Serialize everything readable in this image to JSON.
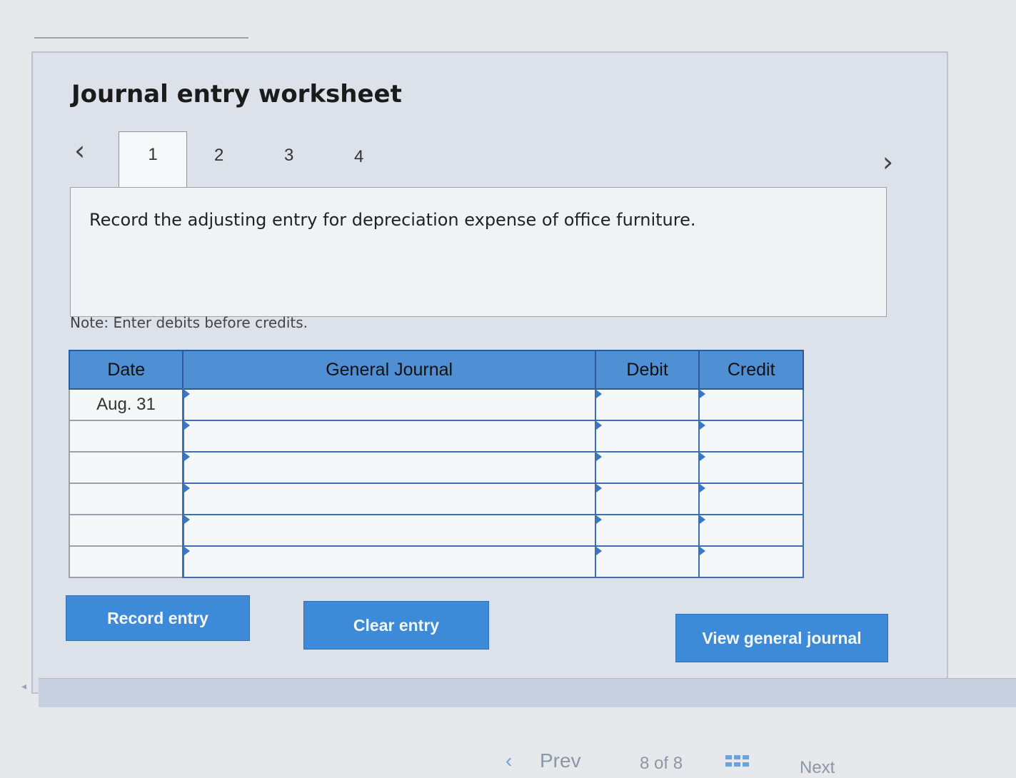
{
  "worksheet": {
    "title": "Journal entry worksheet",
    "tabs": [
      "1",
      "2",
      "3",
      "4"
    ],
    "active_tab": "1",
    "prompt": "Record the adjusting entry for depreciation expense of office furniture.",
    "note": "Note: Enter debits before credits."
  },
  "table": {
    "headers": {
      "date": "Date",
      "journal": "General Journal",
      "debit": "Debit",
      "credit": "Credit"
    },
    "rows": [
      {
        "date": "Aug. 31",
        "account": "",
        "debit": "",
        "credit": ""
      },
      {
        "date": "",
        "account": "",
        "debit": "",
        "credit": ""
      },
      {
        "date": "",
        "account": "",
        "debit": "",
        "credit": ""
      },
      {
        "date": "",
        "account": "",
        "debit": "",
        "credit": ""
      },
      {
        "date": "",
        "account": "",
        "debit": "",
        "credit": ""
      },
      {
        "date": "",
        "account": "",
        "debit": "",
        "credit": ""
      }
    ]
  },
  "buttons": {
    "record": "Record entry",
    "clear": "Clear entry",
    "view": "View general journal"
  },
  "pagination": {
    "prev_label": "Prev",
    "page_text": "8 of 8",
    "next_label": "Next"
  },
  "colors": {
    "accent": "#3d8ad8",
    "header": "#4f8fd4",
    "panel": "#dde1ea"
  },
  "icons": {
    "prev": "chevron-left-icon",
    "next": "chevron-right-icon",
    "grid": "grid-icon"
  }
}
